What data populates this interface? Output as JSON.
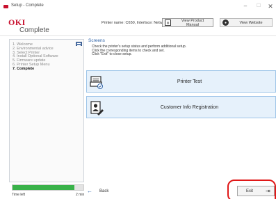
{
  "window": {
    "title": "Setup - Complete",
    "minimize_glyph": "–",
    "maximize_glyph": "☐",
    "close_glyph": "✕"
  },
  "header": {
    "logo": "OKI",
    "page_heading": "Complete",
    "printer_name": "Printer name: C650, Interface: Network",
    "view_manual_label": "View Product Manual",
    "view_manual_icon": "manual-icon",
    "view_website_label": "View Website",
    "view_website_icon": "globe-icon"
  },
  "sidebar": {
    "steps": [
      "1. Welcome",
      "2. Environmental advice",
      "3. Select Printer",
      "4. Install Optional Software",
      "5. Firmware update",
      "6. Printer Setup Menu",
      "7. Complete"
    ],
    "active_step": 6,
    "toggle_icon": "collapse-icon"
  },
  "main": {
    "title": "Screens",
    "instructions": [
      "Check the printer's setup status and perform additional setup.",
      "Click the corresponding items to check and set.",
      "Click \"Exit\" to close setup."
    ],
    "menu_items": [
      {
        "label": "Printer Test",
        "icon": "printer-test-icon"
      },
      {
        "label": "Customer Info Registration",
        "icon": "customer-info-icon"
      }
    ]
  },
  "footer": {
    "progress_label": "Time left",
    "progress_time": "2 min",
    "progress_fraction": 0.87,
    "progress_color": "#39b24a",
    "back_label": "Back",
    "back_icon": "arrow-left-icon",
    "exit_label": "Exit",
    "exit_icon": "exit-icon",
    "highlight_color": "#e01818"
  }
}
